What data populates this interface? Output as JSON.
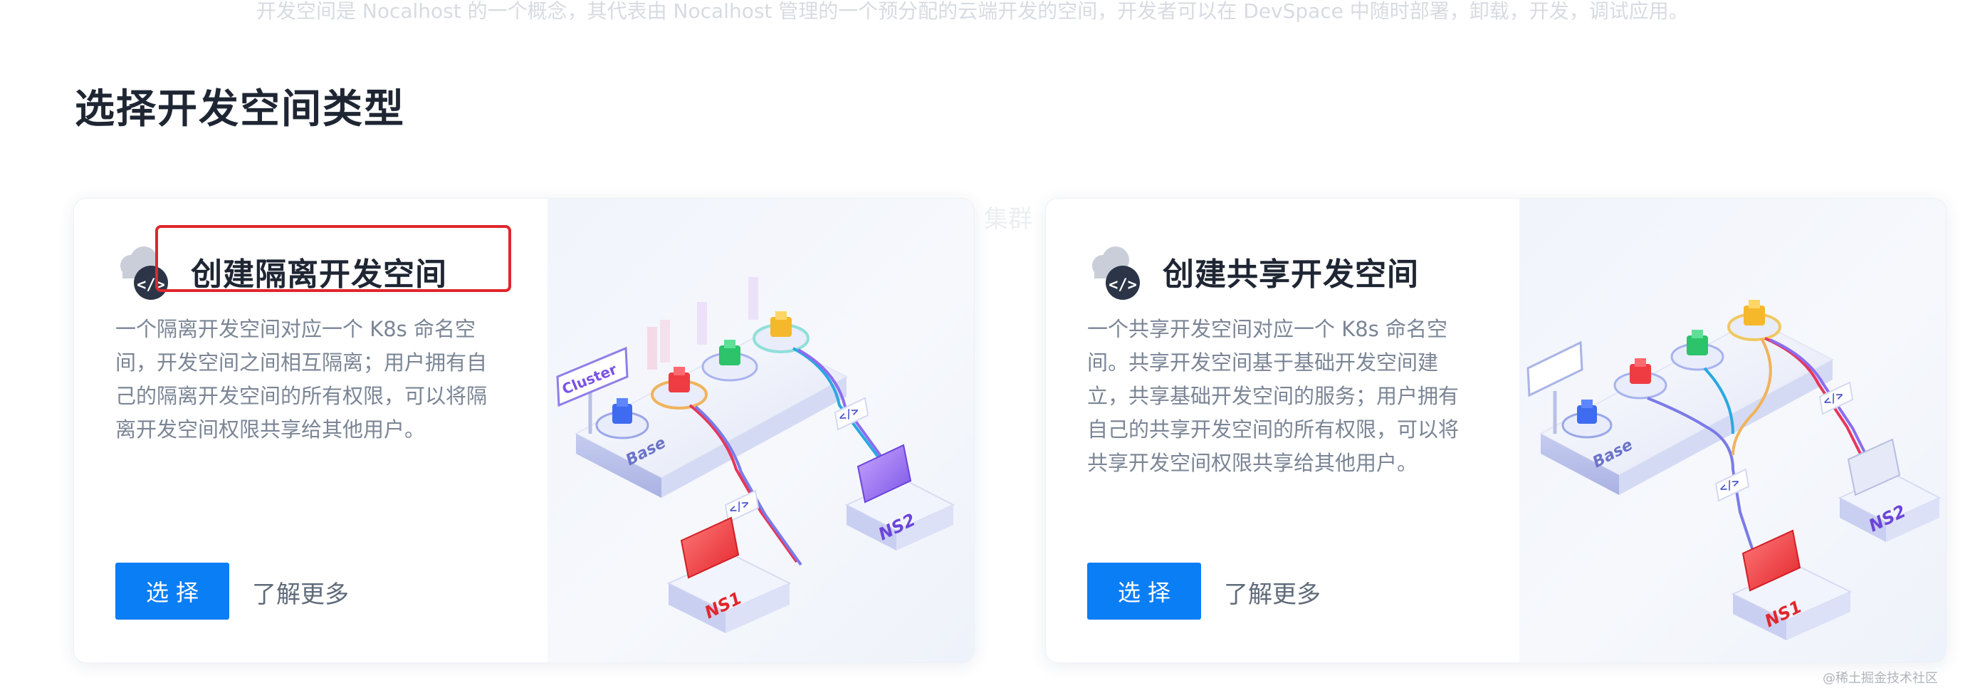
{
  "header": {
    "intro_text": "开发空间是 Nocalhost 的一个概念，其代表由 Nocalhost 管理的一个预分配的云端开发的空间，开发者可以在 DevSpace 中随时部署，卸载，开发，调试应用。"
  },
  "page_title": "选择开发空间类型",
  "background_label": "集群",
  "cards": [
    {
      "title": "创建隔离开发空间",
      "description_lines": [
        "一个隔离开发空间对应一个 K8s 命名空",
        "间，开发空间之间相互隔离；用户拥有自",
        "己的隔离开发空间的所有权限，可以将隔",
        "离开发空间权限共享给其他用户。"
      ],
      "select_label": "选择",
      "learn_more_label": "了解更多",
      "icon": "cloud-code-icon",
      "diagram_labels": {
        "cluster": "Cluster",
        "base": "Base",
        "ns1": "NS1",
        "ns2": "NS2",
        "code": "</>"
      }
    },
    {
      "title": "创建共享开发空间",
      "description_lines": [
        "一个共享开发空间对应一个 K8s 命名空",
        "间。共享开发空间基于基础开发空间建",
        "立，共享基础开发空间的服务；用户拥有",
        "自己的共享开发空间的所有权限，可以将",
        "共享开发空间权限共享给其他用户。"
      ],
      "select_label": "选择",
      "learn_more_label": "了解更多",
      "icon": "cloud-code-icon",
      "diagram_labels": {
        "base": "Base",
        "ns1": "NS1",
        "ns2": "NS2",
        "code": "</>"
      }
    }
  ],
  "watermark": "@稀土掘金技术社区",
  "colors": {
    "primary": "#0a7ef5",
    "highlight": "#e0262c",
    "title": "#1f2633",
    "description": "#7b8595"
  }
}
